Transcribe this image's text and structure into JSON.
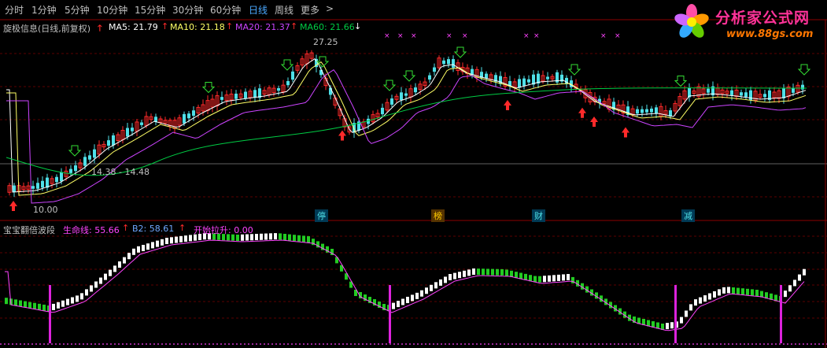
{
  "toolbar": {
    "tabs": [
      "分时",
      "1分钟",
      "5分钟",
      "10分钟",
      "15分钟",
      "30分钟",
      "60分钟",
      "日线",
      "周线",
      "更多"
    ],
    "active_tab": "日线",
    "more_arrow": ">"
  },
  "logo": {
    "title": "分析家公式网",
    "url_text": "www.88gs.com"
  },
  "main_panel": {
    "indicator_title": "旋极信息(日线,前复权)",
    "ma5": "MA5: 21.79",
    "ma10": "MA10: 21.18",
    "ma20": "MA20: 21.37",
    "ma60": "MA60: 21.66",
    "high_label": "27.25",
    "low_label": "10.00",
    "range_label": "14.38 - 14.48",
    "event_tags": [
      "停",
      "榜",
      "财",
      "减"
    ],
    "colors": {
      "ma5": "#ffffff",
      "ma10": "#ffff66",
      "ma20": "#cc44ff",
      "ma60": "#00cc44",
      "up": "#ff2a2a",
      "down": "#4fe0e8"
    }
  },
  "sub_panel": {
    "indicator_title": "宝宝翻倍波段",
    "life_line": "生命线: 55.66",
    "b2": "B2: 58.61",
    "start_rise": "开始拉升: 0.00",
    "colors": {
      "life": "#ff44ff",
      "b2": "#6fa8ff",
      "start": "#ff44ff",
      "up": "#ffffff",
      "down": "#22cc22"
    }
  }
}
